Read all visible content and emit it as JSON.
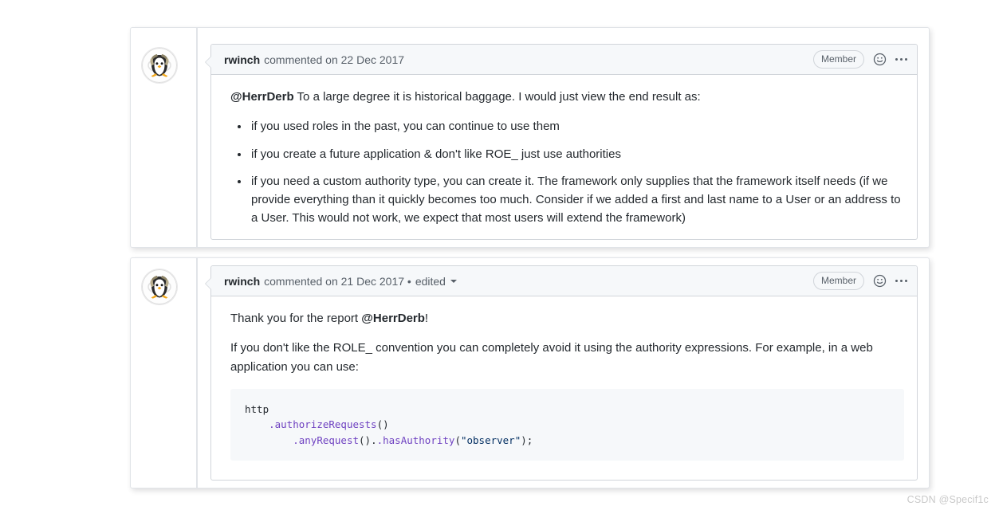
{
  "watermark": "CSDN @Specif1c",
  "comments": [
    {
      "author": "rwinch",
      "meta": "commented on 22 Dec 2017",
      "edited_label": "",
      "badge": "Member",
      "reaction_icon": "smiley-icon",
      "menu_icon": "kebab-menu-icon",
      "avatar_alt": "penguin-avatar",
      "intro_mention": "@HerrDerb",
      "intro_text": " To a large degree it is historical baggage. I would just view the end result as:",
      "bullets": [
        "if you used roles in the past, you can continue to use them",
        "if you create a future application & don't like ROE_ just use authorities",
        "if you need a custom authority type, you can create it. The framework only supplies that the framework itself needs (if we provide everything than it quickly becomes too much. Consider if we added a first and last name to a User or an address to a User. This would not work, we expect that most users will extend the framework)"
      ]
    },
    {
      "author": "rwinch",
      "meta": "commented on 21 Dec 2017 •",
      "edited_label": "edited",
      "badge": "Member",
      "reaction_icon": "smiley-icon",
      "menu_icon": "kebab-menu-icon",
      "avatar_alt": "penguin-avatar",
      "para1_pre": "Thank you for the report ",
      "para1_mention": "@HerrDerb",
      "para1_post": "!",
      "para2": "If you don't like the ROLE_ convention you can completely avoid it using the authority expressions. For example, in a web application you can use:",
      "code": {
        "line1": "http",
        "line2_indent": "    ",
        "line2_fn": ".authorizeRequests",
        "line2_paren": "()",
        "line3_indent": "        ",
        "line3_fn1": ".anyRequest",
        "line3_mid": "().",
        "line3_fn2": ".hasAuthority",
        "line3_open": "(",
        "line3_str": "\"observer\"",
        "line3_close": ");"
      }
    }
  ],
  "colors": {
    "link": "#0366d6",
    "code_fn": "#6f42c1",
    "code_str": "#032f62",
    "muted": "#586069",
    "border": "#d1d5da",
    "header_bg": "#f6f8fa"
  }
}
